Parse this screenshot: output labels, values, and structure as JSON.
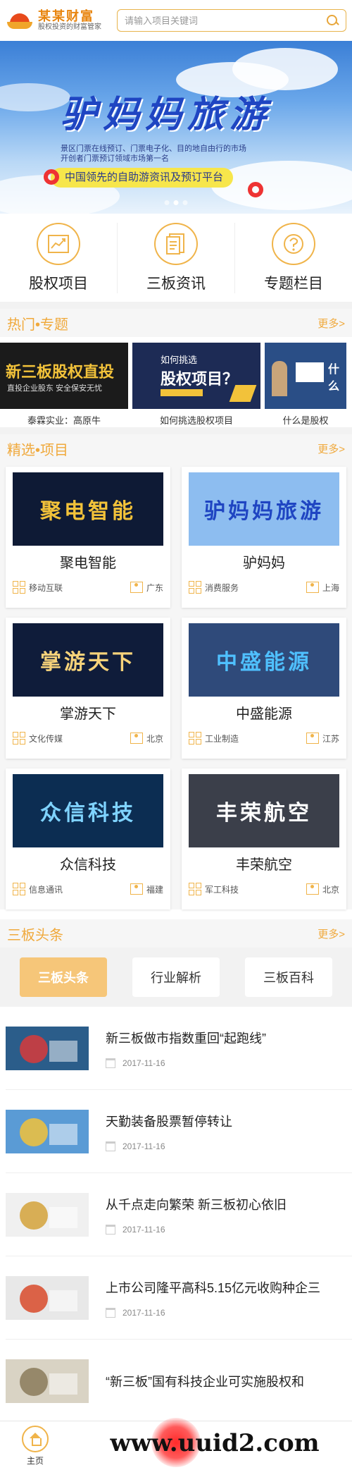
{
  "header": {
    "logo_name": "某某财富",
    "logo_slogan": "股权投资的财富管家",
    "search_placeholder": "请输入项目关键词"
  },
  "banner": {
    "title": "驴妈妈旅游",
    "desc": "景区门票在线预订、门票电子化、目的地自由行的市场开创者门票预订领域市场第一名",
    "pill": "中国领先的自助游资讯及预订平台",
    "active_index": 1,
    "dot_count": 3
  },
  "quicknav": [
    {
      "label": "股权项目",
      "icon": "chart-up-icon"
    },
    {
      "label": "三板资讯",
      "icon": "document-icon"
    },
    {
      "label": "专题栏目",
      "icon": "question-icon"
    }
  ],
  "hot": {
    "title": "热门•专题",
    "more": "更多>",
    "items": [
      {
        "caption": "泰霖实业：高原牛",
        "img_text": "新三板股权直投",
        "img_sub": "直投企业股东  安全保安无忧",
        "bg": "#1b1b1b",
        "fg": "#f2c23a"
      },
      {
        "caption": "如何挑选股权项目",
        "img_text": "股权项目？",
        "img_sub": "如何挑选",
        "bg": "#1d2b55",
        "fg": "#ffffff"
      },
      {
        "caption": "什么是股权",
        "img_text": "什么",
        "img_sub": "",
        "bg": "#2a4e86",
        "fg": "#ffffff"
      }
    ]
  },
  "projects": {
    "title": "精选•项目",
    "more": "更多>",
    "items": [
      {
        "name": "聚电智能",
        "industry": "移动互联",
        "region": "广东",
        "img_text": "聚电智能",
        "bg": "#0e1a35",
        "fg": "#f2c23a"
      },
      {
        "name": "驴妈妈",
        "industry": "消费服务",
        "region": "上海",
        "img_text": "驴妈妈旅游",
        "bg": "#8dbdf0",
        "fg": "#1f45c2"
      },
      {
        "name": "掌游天下",
        "industry": "文化传媒",
        "region": "北京",
        "img_text": "掌游天下",
        "bg": "#0f1c3a",
        "fg": "#f6d27a"
      },
      {
        "name": "中盛能源",
        "industry": "工业制造",
        "region": "江苏",
        "img_text": "中盛能源",
        "bg": "#2f4a7a",
        "fg": "#4fc0ff"
      },
      {
        "name": "众信科技",
        "industry": "信息通讯",
        "region": "福建",
        "img_text": "众信科技",
        "bg": "#0c2d52",
        "fg": "#7fd3ff"
      },
      {
        "name": "丰荣航空",
        "industry": "军工科技",
        "region": "北京",
        "img_text": "丰荣航空",
        "bg": "#3b3f4a",
        "fg": "#ffffff"
      }
    ]
  },
  "headlines": {
    "title": "三板头条",
    "more": "更多>",
    "tabs": [
      "三板头条",
      "行业解析",
      "三板百科"
    ],
    "items": [
      {
        "title": "新三板做市指数重回“起跑线”",
        "date": "2017-11-16",
        "bg": "#2b5d8a",
        "accent": "#d83a3a"
      },
      {
        "title": "天勤装备股票暂停转让",
        "date": "2017-11-16",
        "bg": "#5a9bd5",
        "accent": "#f2c23a"
      },
      {
        "title": "从千点走向繁荣 新三板初心依旧",
        "date": "2017-11-16",
        "bg": "#f0f0f0",
        "accent": "#d4a23a"
      },
      {
        "title": "上市公司隆平高科5.15亿元收购种企三",
        "date": "2017-11-16",
        "bg": "#e8e8e8",
        "accent": "#d84a2a"
      },
      {
        "title": "“新三板”国有科技企业可实施股权和",
        "date": "",
        "bg": "#d9d3c4",
        "accent": "#8a7a5a"
      }
    ]
  },
  "footer": {
    "home_label": "主页",
    "watermark": "www.uuid2.com"
  }
}
